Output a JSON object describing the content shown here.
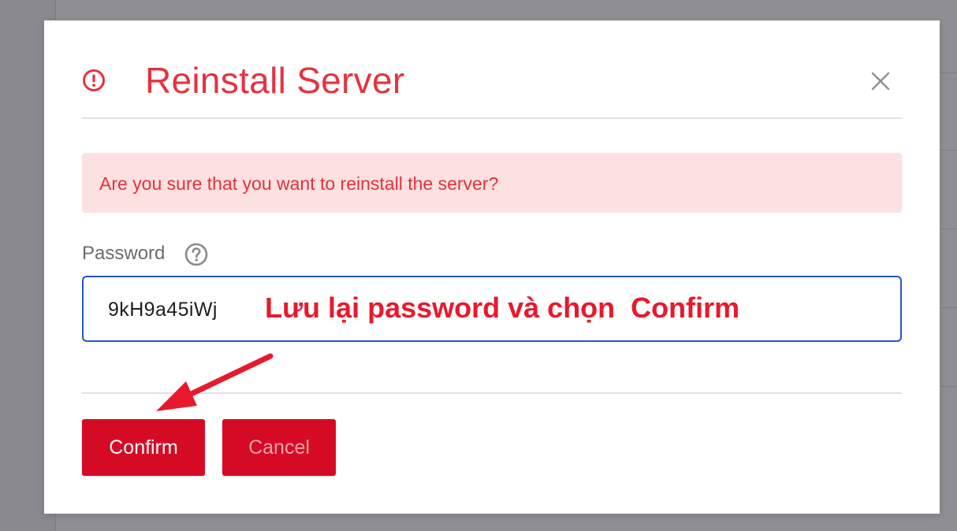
{
  "dialog": {
    "title": "Reinstall Server",
    "alert_message": "Are you sure that you want to reinstall the server?",
    "password_label": "Password",
    "password_value": "9kH9a45iWj",
    "confirm_label": "Confirm",
    "cancel_label": "Cancel"
  },
  "annotation": {
    "text": "Lưu lại password và chọn  Confirm"
  },
  "colors": {
    "accent_red": "#e5333f",
    "button_red": "#d50b25",
    "alert_bg": "#fde0e0",
    "input_border": "#2653c9"
  },
  "icons": {
    "title_icon": "alert-circle-icon",
    "close_icon": "close-icon",
    "help_icon": "question-circle-icon"
  }
}
